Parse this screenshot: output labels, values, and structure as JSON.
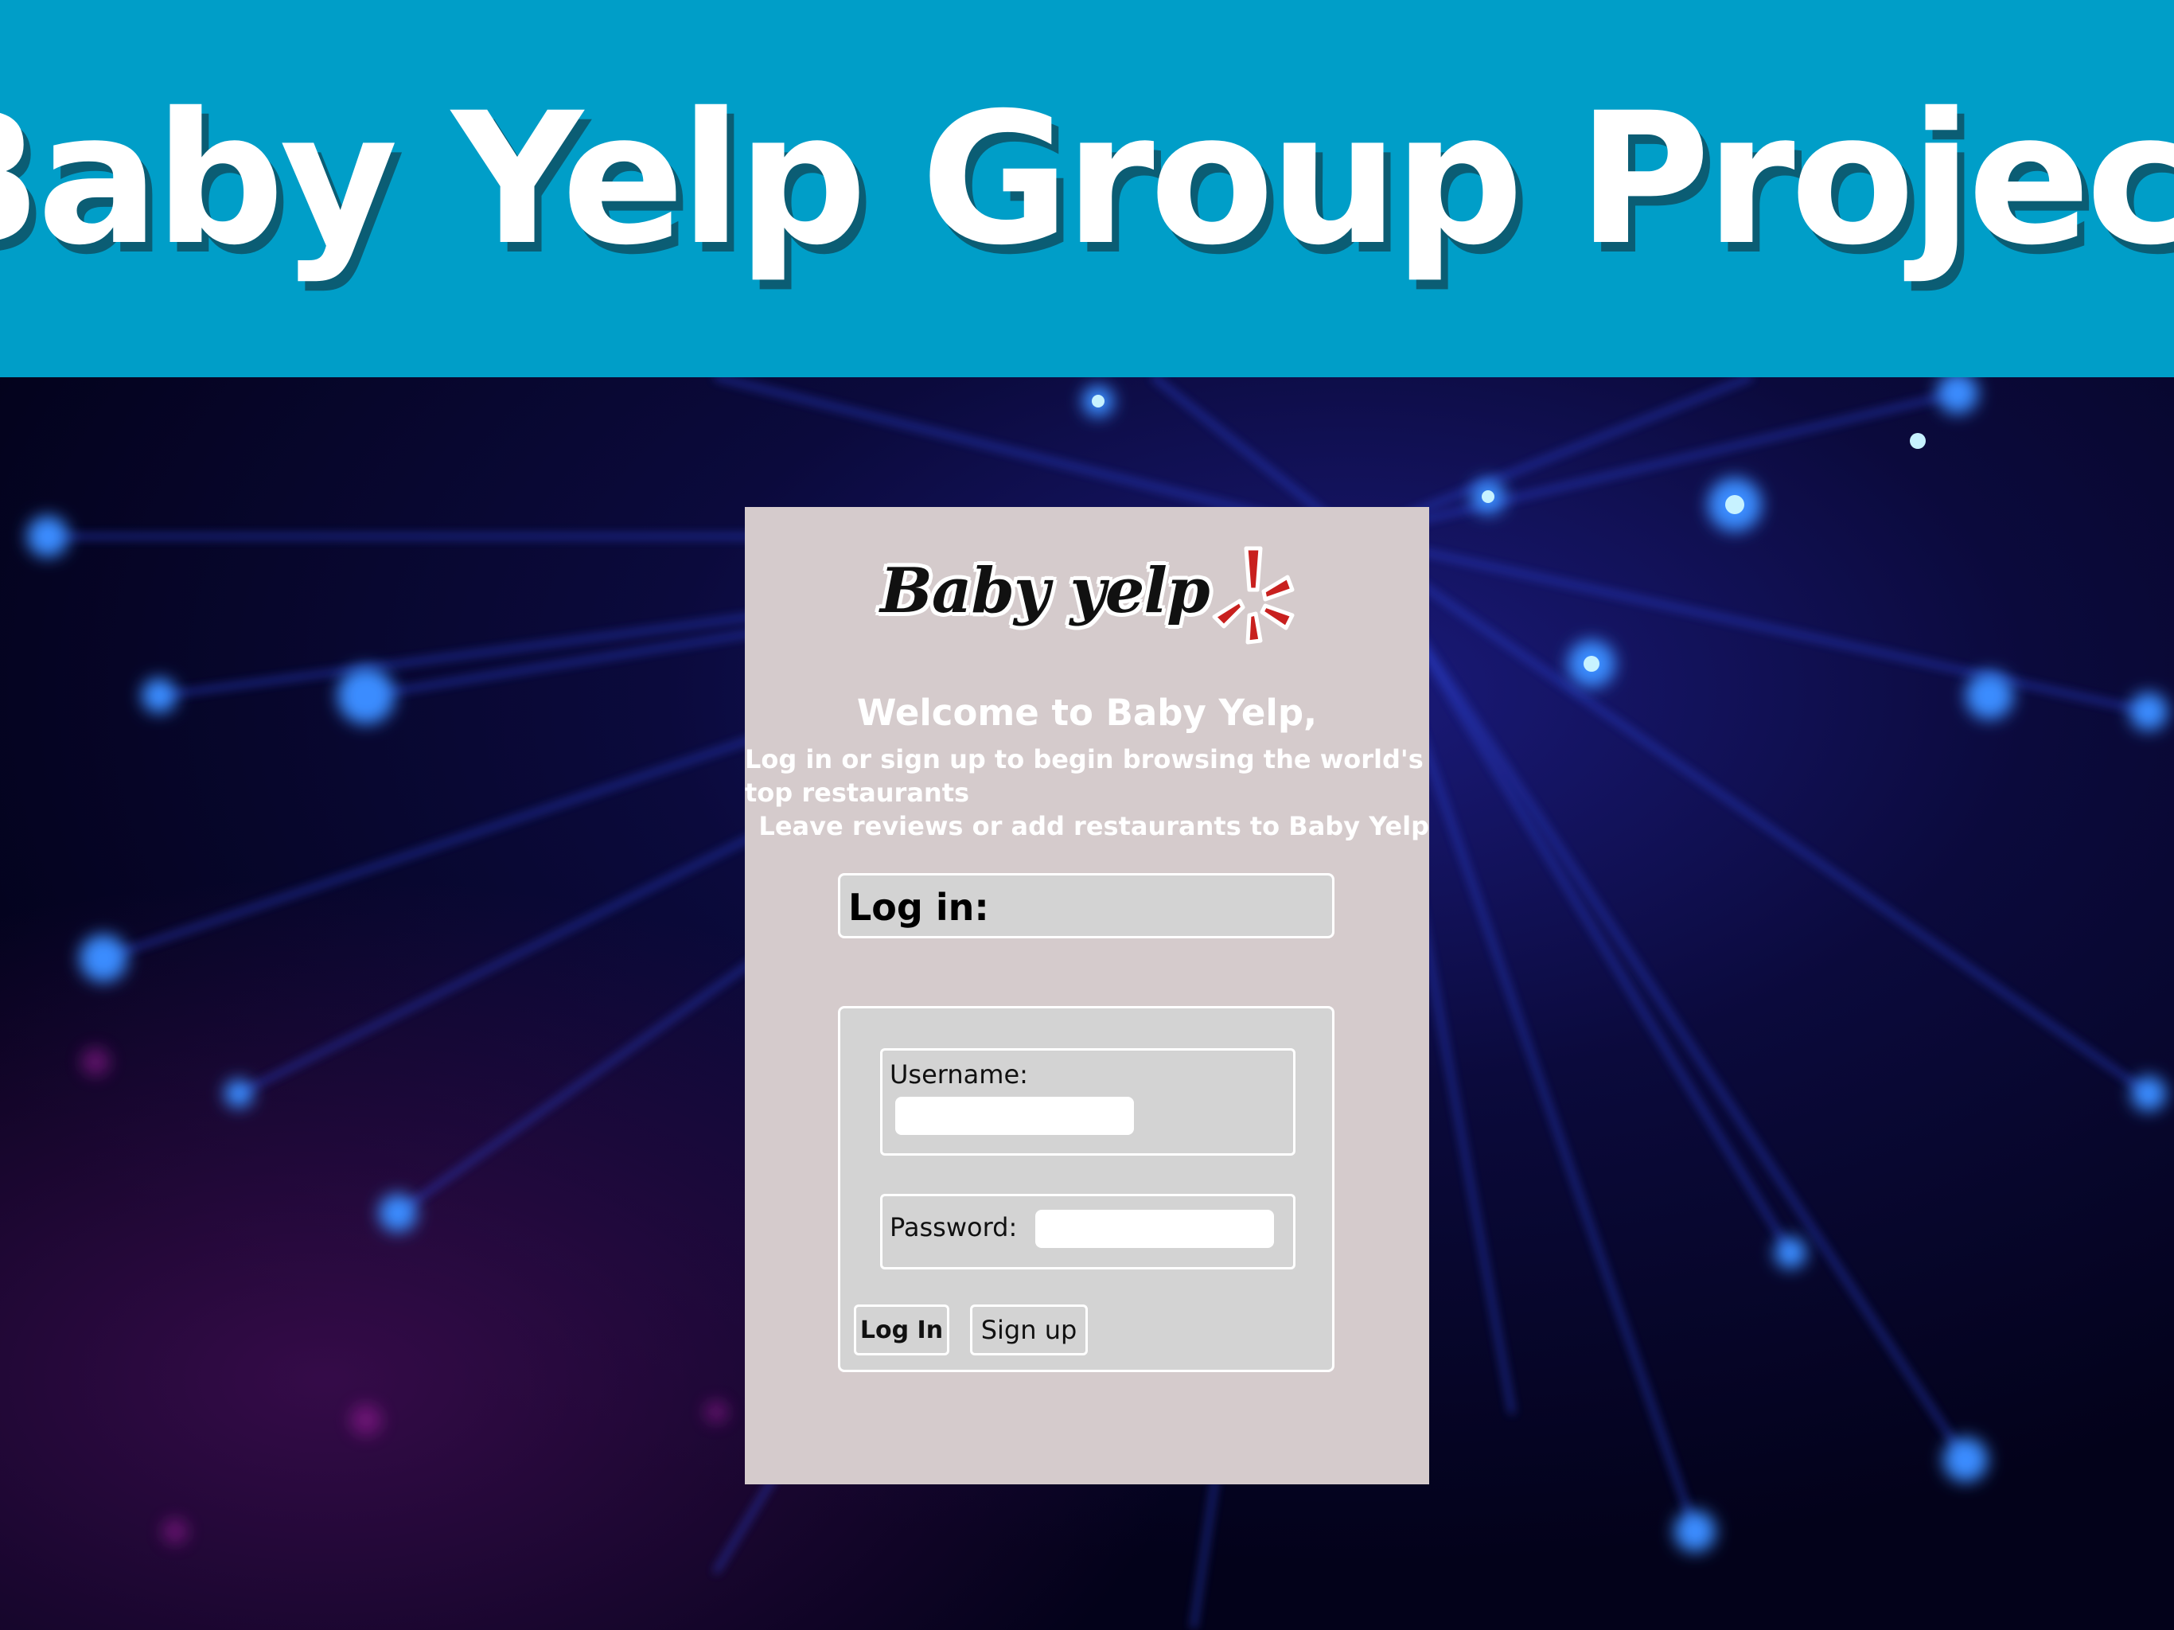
{
  "banner": {
    "title": "Baby Yelp Group Project",
    "background_color": "#009ec8"
  },
  "card": {
    "background_color": "#d5cbcc",
    "logo": {
      "text": "Baby yelp",
      "icon": "yelp-burst-icon",
      "icon_color": "#c8201e"
    },
    "welcome": {
      "title": "Welcome to Baby Yelp,",
      "line1": "Log in or sign up to begin browsing the world's top restaurants",
      "line2": "Leave reviews or add restaurants to Baby Yelp"
    },
    "login_heading": "Log in:",
    "form": {
      "username_label": "Username:",
      "username_value": "",
      "password_label": "Password:",
      "password_value": "",
      "login_button": "Log In",
      "signup_button": "Sign up"
    }
  }
}
